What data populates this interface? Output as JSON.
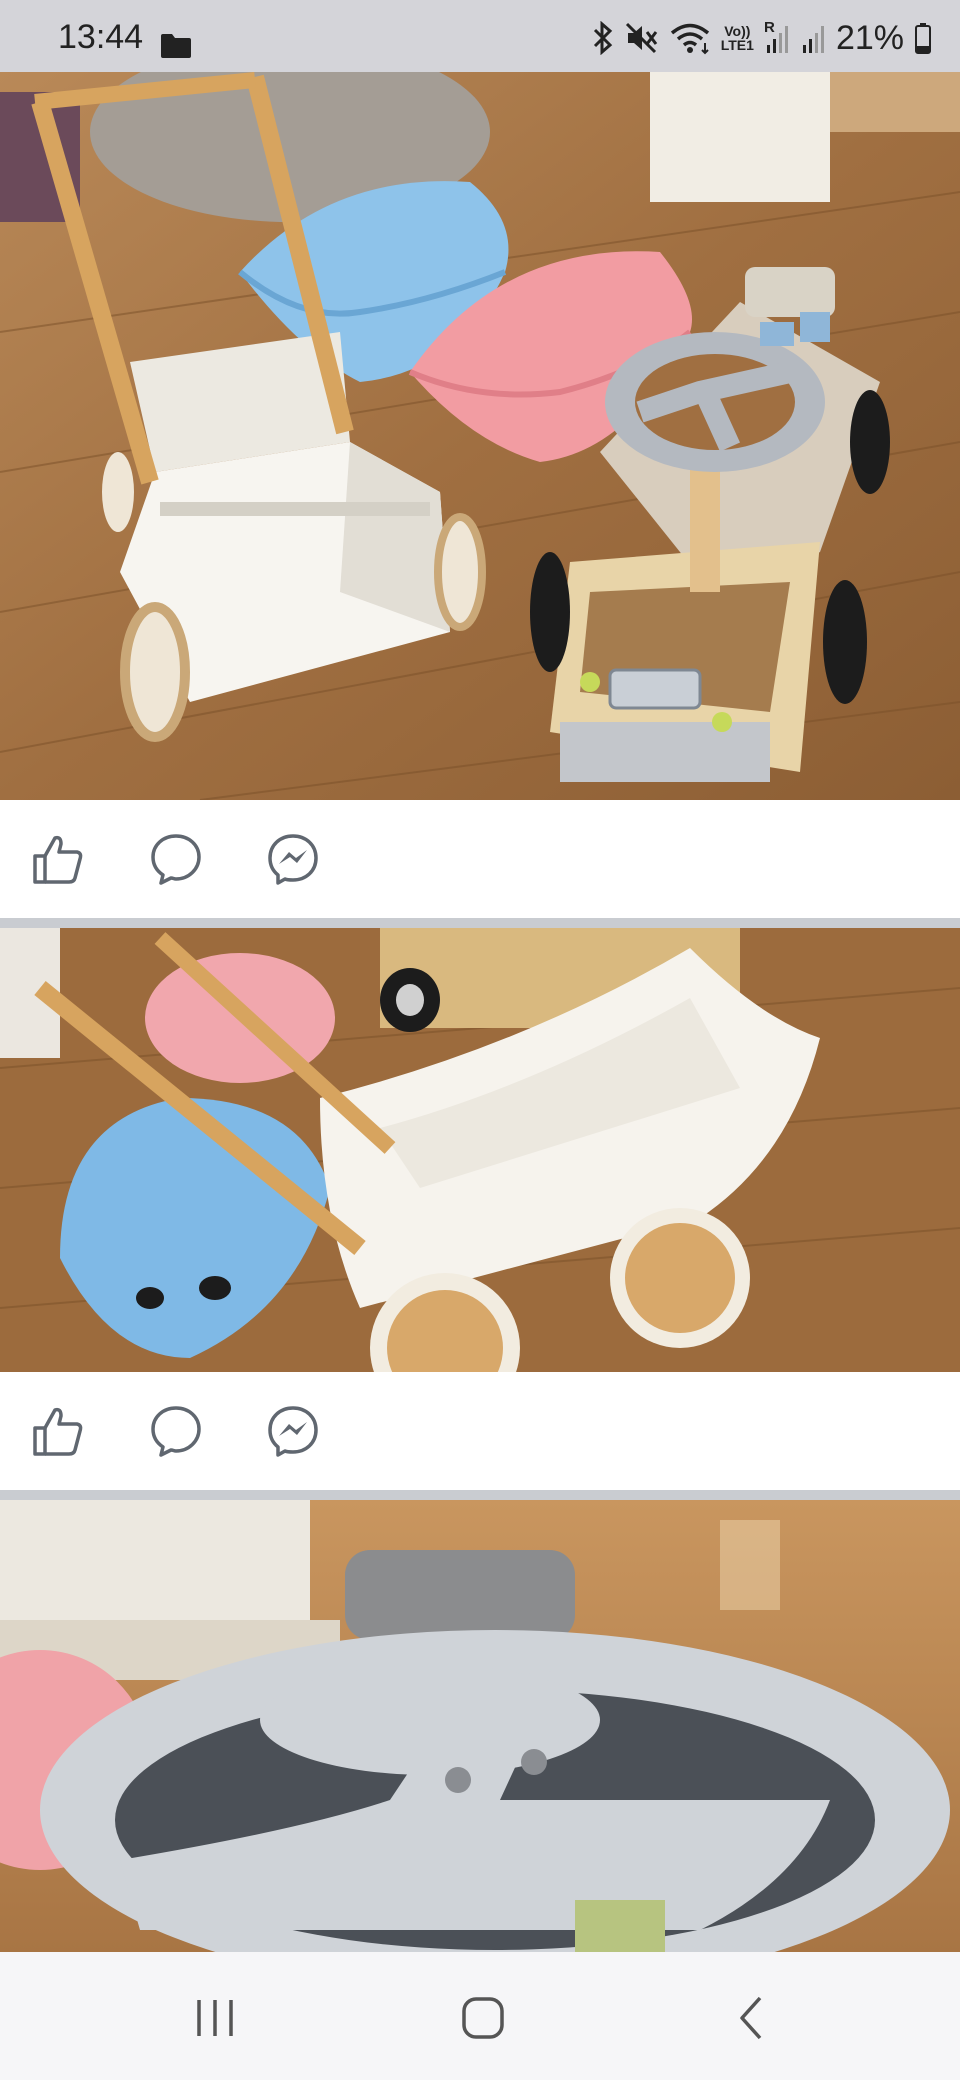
{
  "status_bar": {
    "time": "13:44",
    "battery_percent": "21%",
    "network_label_top": "Vo))",
    "network_label_bottom": "LTE1",
    "roaming": "R",
    "icons": [
      "folder-icon",
      "bluetooth-icon",
      "mute-icon",
      "wifi-icon",
      "signal-icon",
      "battery-icon"
    ]
  },
  "feed": {
    "posts": [
      {
        "photo": "photo of white wooden doll pram, blue and pink rocker seats, wooden ride-on car",
        "actions": [
          "like-icon",
          "comment-icon",
          "messenger-icon"
        ]
      },
      {
        "photo": "photo of white wooden doll pram with wooden handle next to blue rocker seat",
        "actions": [
          "like-icon",
          "comment-icon",
          "messenger-icon"
        ]
      },
      {
        "photo": "close-up photo of grey steering wheel of wooden ride-on car"
      }
    ]
  },
  "nav_bar": {
    "buttons": [
      "recent-apps-icon",
      "home-icon",
      "back-icon"
    ]
  },
  "colors": {
    "status_bar": "#d4d4d9",
    "divider": "#c9ccd1",
    "icon": "#606770",
    "floor": "#a9794a"
  }
}
